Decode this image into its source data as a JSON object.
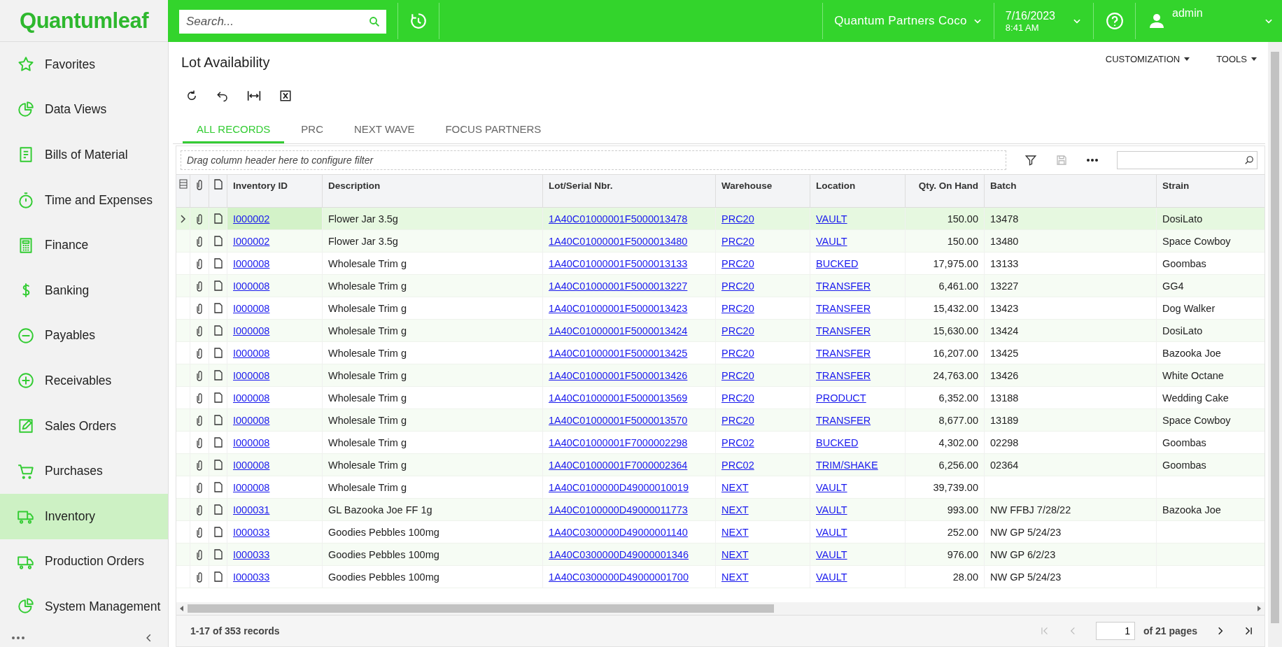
{
  "topbar": {
    "logo": "Quantumleaf",
    "search": {
      "placeholder": "Search..."
    },
    "company": "Quantum Partners Coco",
    "date": "7/16/2023",
    "time": "8:41 AM",
    "user": "admin"
  },
  "sidebar": {
    "items": [
      {
        "label": "Favorites",
        "selected": false
      },
      {
        "label": "Data Views",
        "selected": false
      },
      {
        "label": "Bills of Material",
        "selected": false
      },
      {
        "label": "Time and Expenses",
        "selected": false
      },
      {
        "label": "Finance",
        "selected": false
      },
      {
        "label": "Banking",
        "selected": false
      },
      {
        "label": "Payables",
        "selected": false
      },
      {
        "label": "Receivables",
        "selected": false
      },
      {
        "label": "Sales Orders",
        "selected": false
      },
      {
        "label": "Purchases",
        "selected": false
      },
      {
        "label": "Inventory",
        "selected": true
      },
      {
        "label": "Production Orders",
        "selected": false
      },
      {
        "label": "System Management",
        "selected": false
      }
    ]
  },
  "page": {
    "title": "Lot Availability",
    "menus": [
      "CUSTOMIZATION",
      "TOOLS"
    ]
  },
  "tabs": [
    {
      "label": "ALL RECORDS",
      "selected": true
    },
    {
      "label": "PRC",
      "selected": false
    },
    {
      "label": "NEXT WAVE",
      "selected": false
    },
    {
      "label": "FOCUS PARTNERS",
      "selected": false
    }
  ],
  "grid": {
    "filter_hint": "Drag column header here to configure filter",
    "columns": [
      "Inventory ID",
      "Description",
      "Lot/Serial Nbr.",
      "Warehouse",
      "Location",
      "Qty. On Hand",
      "Batch",
      "Strain"
    ],
    "rows": [
      {
        "selected": true,
        "inventory_id": "I000002",
        "description": "Flower Jar 3.5g",
        "lot": "1A40C01000001F5000013478",
        "warehouse": "PRC20",
        "location": "VAULT",
        "qty": "150.00",
        "batch": "13478",
        "strain": "DosiLato"
      },
      {
        "selected": false,
        "inventory_id": "I000002",
        "description": "Flower Jar 3.5g",
        "lot": "1A40C01000001F5000013480",
        "warehouse": "PRC20",
        "location": "VAULT",
        "qty": "150.00",
        "batch": "13480",
        "strain": "Space Cowboy"
      },
      {
        "selected": false,
        "inventory_id": "I000008",
        "description": "Wholesale Trim g",
        "lot": "1A40C01000001F5000013133",
        "warehouse": "PRC20",
        "location": "BUCKED",
        "qty": "17,975.00",
        "batch": "13133",
        "strain": "Goombas"
      },
      {
        "selected": false,
        "inventory_id": "I000008",
        "description": "Wholesale Trim g",
        "lot": "1A40C01000001F5000013227",
        "warehouse": "PRC20",
        "location": "TRANSFER",
        "qty": "6,461.00",
        "batch": "13227",
        "strain": "GG4"
      },
      {
        "selected": false,
        "inventory_id": "I000008",
        "description": "Wholesale Trim g",
        "lot": "1A40C01000001F5000013423",
        "warehouse": "PRC20",
        "location": "TRANSFER",
        "qty": "15,432.00",
        "batch": "13423",
        "strain": "Dog Walker"
      },
      {
        "selected": false,
        "inventory_id": "I000008",
        "description": "Wholesale Trim g",
        "lot": "1A40C01000001F5000013424",
        "warehouse": "PRC20",
        "location": "TRANSFER",
        "qty": "15,630.00",
        "batch": "13424",
        "strain": "DosiLato"
      },
      {
        "selected": false,
        "inventory_id": "I000008",
        "description": "Wholesale Trim g",
        "lot": "1A40C01000001F5000013425",
        "warehouse": "PRC20",
        "location": "TRANSFER",
        "qty": "16,207.00",
        "batch": "13425",
        "strain": "Bazooka Joe"
      },
      {
        "selected": false,
        "inventory_id": "I000008",
        "description": "Wholesale Trim g",
        "lot": "1A40C01000001F5000013426",
        "warehouse": "PRC20",
        "location": "TRANSFER",
        "qty": "24,763.00",
        "batch": "13426",
        "strain": "White Octane"
      },
      {
        "selected": false,
        "inventory_id": "I000008",
        "description": "Wholesale Trim g",
        "lot": "1A40C01000001F5000013569",
        "warehouse": "PRC20",
        "location": "PRODUCT",
        "qty": "6,352.00",
        "batch": "13188",
        "strain": "Wedding Cake"
      },
      {
        "selected": false,
        "inventory_id": "I000008",
        "description": "Wholesale Trim g",
        "lot": "1A40C01000001F5000013570",
        "warehouse": "PRC20",
        "location": "TRANSFER",
        "qty": "8,677.00",
        "batch": "13189",
        "strain": "Space Cowboy"
      },
      {
        "selected": false,
        "inventory_id": "I000008",
        "description": "Wholesale Trim g",
        "lot": "1A40C01000001F7000002298",
        "warehouse": "PRC02",
        "location": "BUCKED",
        "qty": "4,302.00",
        "batch": "02298",
        "strain": "Goombas"
      },
      {
        "selected": false,
        "inventory_id": "I000008",
        "description": "Wholesale Trim g",
        "lot": "1A40C01000001F7000002364",
        "warehouse": "PRC02",
        "location": "TRIM/SHAKE",
        "qty": "6,256.00",
        "batch": "02364",
        "strain": "Goombas"
      },
      {
        "selected": false,
        "inventory_id": "I000008",
        "description": "Wholesale Trim g",
        "lot": "1A40C0100000D49000010019",
        "warehouse": "NEXT",
        "location": "VAULT",
        "qty": "39,739.00"
      },
      {
        "selected": false,
        "inventory_id": "I000031",
        "description": "GL Bazooka Joe FF 1g",
        "lot": "1A40C0100000D49000011773",
        "warehouse": "NEXT",
        "location": "VAULT",
        "qty": "993.00",
        "batch": "NW FFBJ 7/28/22",
        "strain": "Bazooka Joe"
      },
      {
        "selected": false,
        "inventory_id": "I000033",
        "description": "Goodies Pebbles 100mg",
        "lot": "1A40C0300000D49000001140",
        "warehouse": "NEXT",
        "location": "VAULT",
        "qty": "252.00",
        "batch": "NW GP 5/24/23"
      },
      {
        "selected": false,
        "inventory_id": "I000033",
        "description": "Goodies Pebbles 100mg",
        "lot": "1A40C0300000D49000001346",
        "warehouse": "NEXT",
        "location": "VAULT",
        "qty": "976.00",
        "batch": "NW GP 6/2/23"
      },
      {
        "selected": false,
        "inventory_id": "I000033",
        "description": "Goodies Pebbles 100mg",
        "lot": "1A40C0300000D49000001700",
        "warehouse": "NEXT",
        "location": "VAULT",
        "qty": "28.00",
        "batch": "NW GP 5/24/23"
      }
    ],
    "footer": {
      "records": "1-17 of 353 records",
      "page": "1",
      "pages": "of 21 pages"
    }
  }
}
